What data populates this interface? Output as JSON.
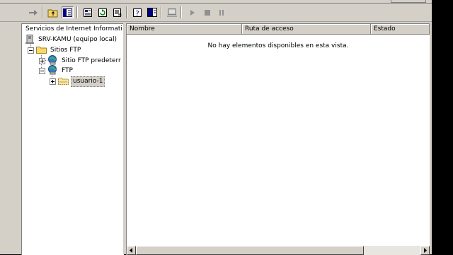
{
  "toolbar": {
    "buttons": [
      "forward-icon",
      "up-folder-icon",
      "show-hide-tree-icon",
      "properties-icon",
      "refresh-icon",
      "export-list-icon",
      "help-icon",
      "show-hide-action-pane-icon",
      "computer-icon",
      "start-icon",
      "stop-icon",
      "pause-icon"
    ]
  },
  "tree": {
    "header": "Servicios de Internet Informati",
    "nodes": [
      {
        "label": "SRV-KAMU (equipo local)",
        "icon": "server-icon"
      },
      {
        "label": "Sitios FTP",
        "icon": "folder-icon"
      },
      {
        "label": "Sitio FTP predeterr",
        "icon": "ftp-site-icon"
      },
      {
        "label": "FTP",
        "icon": "ftp-site-icon"
      },
      {
        "label": "usuario-1",
        "icon": "virtual-directory-icon",
        "selected": true
      }
    ]
  },
  "list": {
    "columns": [
      "Nombre",
      "Ruta de acceso",
      "Estado"
    ],
    "empty_message": "No hay elementos disponibles en esta vista."
  }
}
